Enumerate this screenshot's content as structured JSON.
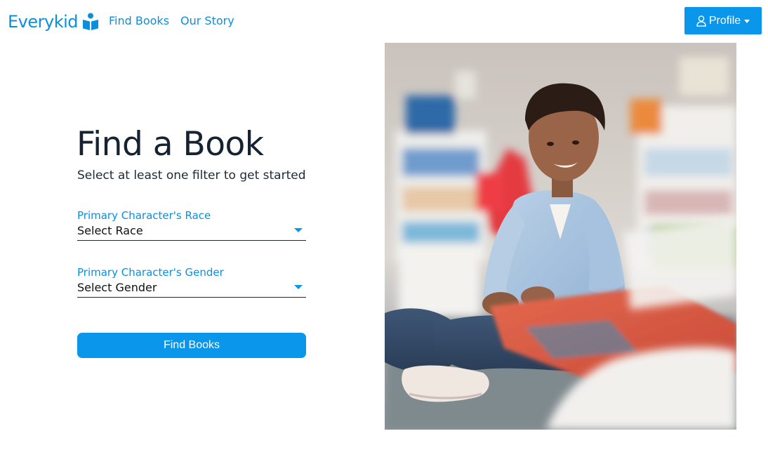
{
  "nav": {
    "brand": "Everykid",
    "links": [
      "Find Books",
      "Our Story"
    ],
    "profile_label": "Profile"
  },
  "main": {
    "title": "Find a Book",
    "subtitle": "Select at least one filter to get started",
    "race_field": {
      "label": "Primary Character's Race",
      "value": "Select Race"
    },
    "gender_field": {
      "label": "Primary Character's Gender",
      "value": "Select Gender"
    },
    "submit_label": "Find Books"
  },
  "colors": {
    "accent": "#0a96ea",
    "link": "#0a8fe0",
    "heading": "#152232"
  },
  "image": {
    "name": "boy-reading-photo"
  }
}
